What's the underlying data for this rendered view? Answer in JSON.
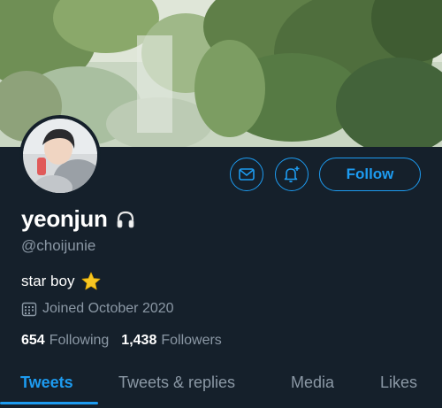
{
  "profile": {
    "display_name": "yeonjun",
    "name_emoji_icon": "headphones-icon",
    "handle": "@choijunie",
    "bio": "star boy",
    "bio_emoji_icon": "star-icon",
    "joined": "Joined October 2020"
  },
  "actions": {
    "follow_label": "Follow",
    "message_icon": "mail-icon",
    "notify_icon": "bell-plus-icon"
  },
  "stats": {
    "following_count": "654",
    "following_label": "Following",
    "followers_count": "1,438",
    "followers_label": "Followers"
  },
  "tabs": [
    {
      "label": "Tweets",
      "active": true
    },
    {
      "label": "Tweets & replies",
      "active": false
    },
    {
      "label": "Media",
      "active": false
    },
    {
      "label": "Likes",
      "active": false
    }
  ],
  "colors": {
    "background": "#15202b",
    "accent": "#1d9bf0",
    "secondary_text": "#8b98a5"
  }
}
